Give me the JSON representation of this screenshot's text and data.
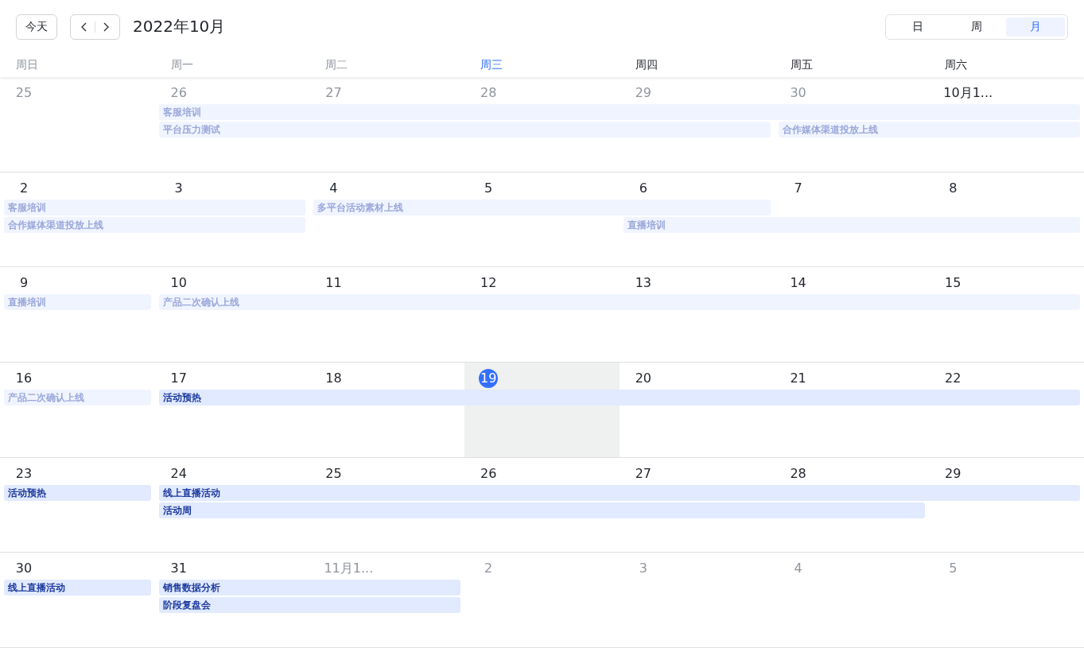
{
  "toolbar": {
    "today_button": "今天",
    "title": "2022年10月",
    "view_switch": [
      {
        "label": "日",
        "selected": false
      },
      {
        "label": "周",
        "selected": false
      },
      {
        "label": "月",
        "selected": true
      }
    ]
  },
  "weekdays": [
    {
      "label": "周日",
      "past": true,
      "today": false
    },
    {
      "label": "周一",
      "past": true,
      "today": false
    },
    {
      "label": "周二",
      "past": true,
      "today": false
    },
    {
      "label": "周三",
      "past": false,
      "today": true
    },
    {
      "label": "周四",
      "past": false,
      "today": false
    },
    {
      "label": "周五",
      "past": false,
      "today": false
    },
    {
      "label": "周六",
      "past": false,
      "today": false
    }
  ],
  "weeks": [
    {
      "days": [
        {
          "label": "25",
          "in_month": false,
          "today": false
        },
        {
          "label": "26",
          "in_month": false,
          "today": false,
          "lanes": [
            {
              "kind": "start",
              "title": "客服培训",
              "past": true
            },
            {
              "kind": "start",
              "title": "平台压力测试",
              "past": true
            }
          ]
        },
        {
          "label": "27",
          "in_month": false,
          "today": false,
          "lanes": [
            {
              "kind": "continue"
            },
            {
              "kind": "continue"
            }
          ]
        },
        {
          "label": "28",
          "in_month": false,
          "today": false,
          "lanes": [
            {
              "kind": "continue"
            },
            {
              "kind": "continue"
            }
          ]
        },
        {
          "label": "29",
          "in_month": false,
          "today": false,
          "lanes": [
            {
              "kind": "continue"
            },
            {
              "kind": "continue"
            }
          ]
        },
        {
          "label": "30",
          "in_month": false,
          "today": false,
          "lanes": [
            {
              "kind": "continue"
            },
            {
              "kind": "start",
              "title": "合作媒体渠道投放上线",
              "past": true
            }
          ]
        },
        {
          "label": "10月1...",
          "in_month": true,
          "today": false,
          "lanes": [
            {
              "kind": "continue"
            },
            {
              "kind": "continue"
            }
          ]
        }
      ]
    },
    {
      "days": [
        {
          "label": "2",
          "in_month": true,
          "today": false,
          "lanes": [
            {
              "kind": "start",
              "title": "客服培训",
              "past": true
            },
            {
              "kind": "start",
              "title": "合作媒体渠道投放上线",
              "past": true
            }
          ]
        },
        {
          "label": "3",
          "in_month": true,
          "today": false,
          "lanes": [
            {
              "kind": "continue"
            },
            {
              "kind": "continue"
            }
          ]
        },
        {
          "label": "4",
          "in_month": true,
          "today": false,
          "lanes": [
            {
              "kind": "start",
              "title": "多平台活动素材上线",
              "past": true
            }
          ]
        },
        {
          "label": "5",
          "in_month": true,
          "today": false,
          "lanes": [
            {
              "kind": "continue"
            }
          ]
        },
        {
          "label": "6",
          "in_month": true,
          "today": false,
          "lanes": [
            {
              "kind": "continue"
            },
            {
              "kind": "start",
              "title": "直播培训",
              "past": true
            }
          ]
        },
        {
          "label": "7",
          "in_month": true,
          "today": false,
          "lanes": [
            {
              "kind": "none"
            },
            {
              "kind": "continue"
            }
          ]
        },
        {
          "label": "8",
          "in_month": true,
          "today": false,
          "lanes": [
            {
              "kind": "none"
            },
            {
              "kind": "continue"
            }
          ]
        }
      ]
    },
    {
      "days": [
        {
          "label": "9",
          "in_month": true,
          "today": false,
          "lanes": [
            {
              "kind": "start",
              "title": "直播培训",
              "past": true
            }
          ]
        },
        {
          "label": "10",
          "in_month": true,
          "today": false,
          "lanes": [
            {
              "kind": "start",
              "title": "产品二次确认上线",
              "past": true
            }
          ]
        },
        {
          "label": "11",
          "in_month": true,
          "today": false,
          "lanes": [
            {
              "kind": "continue"
            }
          ]
        },
        {
          "label": "12",
          "in_month": true,
          "today": false,
          "lanes": [
            {
              "kind": "continue"
            }
          ]
        },
        {
          "label": "13",
          "in_month": true,
          "today": false,
          "lanes": [
            {
              "kind": "continue"
            }
          ]
        },
        {
          "label": "14",
          "in_month": true,
          "today": false,
          "lanes": [
            {
              "kind": "continue"
            }
          ]
        },
        {
          "label": "15",
          "in_month": true,
          "today": false,
          "lanes": [
            {
              "kind": "continue"
            }
          ]
        }
      ]
    },
    {
      "days": [
        {
          "label": "16",
          "in_month": true,
          "today": false,
          "lanes": [
            {
              "kind": "start",
              "title": "产品二次确认上线",
              "past": true
            }
          ]
        },
        {
          "label": "17",
          "in_month": true,
          "today": false,
          "lanes": [
            {
              "kind": "start",
              "title": "活动预热",
              "past": false
            }
          ]
        },
        {
          "label": "18",
          "in_month": true,
          "today": false,
          "lanes": [
            {
              "kind": "continue"
            }
          ]
        },
        {
          "label": "19",
          "in_month": true,
          "today": true,
          "lanes": [
            {
              "kind": "continue"
            }
          ]
        },
        {
          "label": "20",
          "in_month": true,
          "today": false,
          "lanes": [
            {
              "kind": "continue"
            }
          ]
        },
        {
          "label": "21",
          "in_month": true,
          "today": false,
          "lanes": [
            {
              "kind": "continue"
            }
          ]
        },
        {
          "label": "22",
          "in_month": true,
          "today": false,
          "lanes": [
            {
              "kind": "continue"
            }
          ]
        }
      ]
    },
    {
      "days": [
        {
          "label": "23",
          "in_month": true,
          "today": false,
          "lanes": [
            {
              "kind": "start",
              "title": "活动预热",
              "past": false
            }
          ]
        },
        {
          "label": "24",
          "in_month": true,
          "today": false,
          "lanes": [
            {
              "kind": "start",
              "title": "线上直播活动",
              "past": false
            },
            {
              "kind": "start",
              "title": "活动周",
              "past": false
            }
          ]
        },
        {
          "label": "25",
          "in_month": true,
          "today": false,
          "lanes": [
            {
              "kind": "continue"
            },
            {
              "kind": "continue"
            }
          ]
        },
        {
          "label": "26",
          "in_month": true,
          "today": false,
          "lanes": [
            {
              "kind": "continue"
            },
            {
              "kind": "continue"
            }
          ]
        },
        {
          "label": "27",
          "in_month": true,
          "today": false,
          "lanes": [
            {
              "kind": "continue"
            },
            {
              "kind": "continue"
            }
          ]
        },
        {
          "label": "28",
          "in_month": true,
          "today": false,
          "lanes": [
            {
              "kind": "continue"
            },
            {
              "kind": "continue"
            }
          ]
        },
        {
          "label": "29",
          "in_month": true,
          "today": false,
          "lanes": [
            {
              "kind": "continue"
            }
          ]
        }
      ]
    },
    {
      "days": [
        {
          "label": "30",
          "in_month": true,
          "today": false,
          "lanes": [
            {
              "kind": "start",
              "title": "线上直播活动",
              "past": false
            }
          ]
        },
        {
          "label": "31",
          "in_month": true,
          "today": false,
          "lanes": [
            {
              "kind": "start",
              "title": "销售数据分析",
              "past": false
            },
            {
              "kind": "start",
              "title": "阶段复盘会",
              "past": false
            }
          ]
        },
        {
          "label": "11月1...",
          "in_month": false,
          "today": false,
          "lanes": [
            {
              "kind": "continue"
            },
            {
              "kind": "continue"
            }
          ]
        },
        {
          "label": "2",
          "in_month": false,
          "today": false
        },
        {
          "label": "3",
          "in_month": false,
          "today": false
        },
        {
          "label": "4",
          "in_month": false,
          "today": false
        },
        {
          "label": "5",
          "in_month": false,
          "today": false
        }
      ]
    }
  ]
}
